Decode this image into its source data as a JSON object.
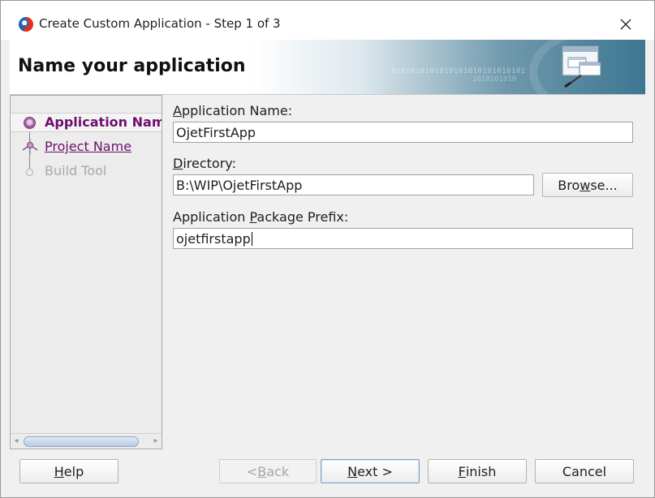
{
  "window": {
    "title": "Create Custom Application - Step 1 of 3"
  },
  "banner": {
    "title": "Name your application",
    "decoration_text": "0101010101010101010101010101",
    "decoration_text2": "1010101010"
  },
  "nav": {
    "steps": [
      {
        "label": "Application Name",
        "state": "current"
      },
      {
        "label": "Project Name",
        "state": "link"
      },
      {
        "label": "Build Tool",
        "state": "disabled"
      }
    ]
  },
  "form": {
    "app_name": {
      "label_mnemonic": "A",
      "label_rest": "pplication Name:",
      "value": "OjetFirstApp"
    },
    "directory": {
      "label_mnemonic": "D",
      "label_rest": "irectory:",
      "value": "B:\\WIP\\OjetFirstApp",
      "browse_pre": "Bro",
      "browse_mnemonic": "w",
      "browse_post": "se..."
    },
    "package_prefix": {
      "label_pre": "Application ",
      "label_mnemonic": "P",
      "label_rest": "ackage Prefix:",
      "value": "ojetfirstapp"
    }
  },
  "buttons": {
    "help": {
      "mnemonic": "H",
      "rest": "elp"
    },
    "back": {
      "pre": "< ",
      "mnemonic": "B",
      "rest": "ack"
    },
    "next": {
      "mnemonic": "N",
      "rest": "ext >"
    },
    "finish": {
      "mnemonic": "F",
      "rest": "inish"
    },
    "cancel": {
      "label": "Cancel"
    }
  },
  "colors": {
    "nav_accent": "#6d0f6d",
    "disabled_text": "#a8a8a8",
    "banner_blue": "#3d7691"
  }
}
